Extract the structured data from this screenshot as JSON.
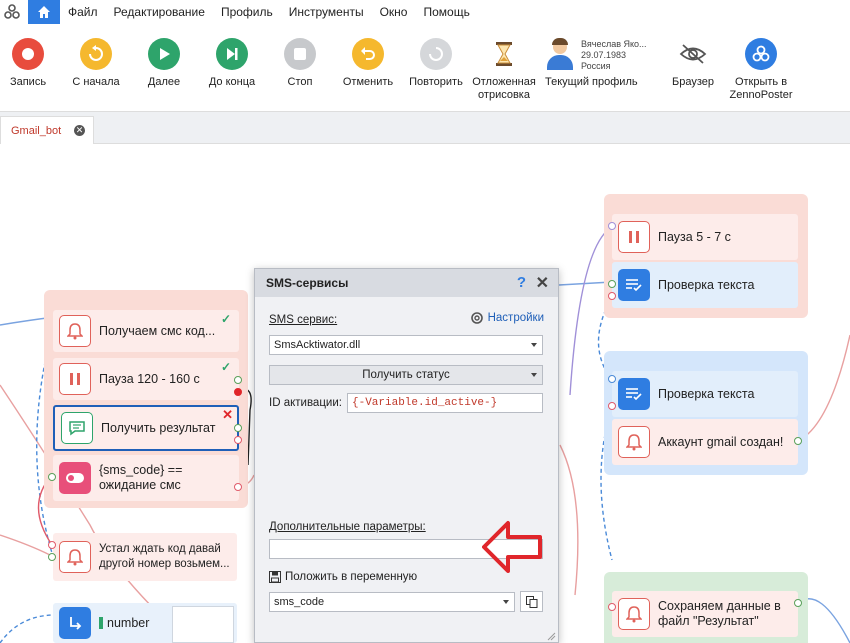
{
  "menu": {
    "items": [
      "Файл",
      "Редактирование",
      "Профиль",
      "Инструменты",
      "Окно",
      "Помощь"
    ]
  },
  "toolbar": {
    "record": "Запись",
    "from_start": "С начала",
    "next": "Далее",
    "to_end": "До конца",
    "stop": "Стоп",
    "undo": "Отменить",
    "repeat": "Повторить",
    "deferred_line1": "Отложенная",
    "deferred_line2": "отрисовка",
    "profile_name": "Вячеслав Яко...",
    "profile_date": "29.07.1983",
    "profile_country": "Россия",
    "current_profile": "Текущий профиль",
    "browser": "Браузер",
    "open_line1": "Открыть в",
    "open_line2": "ZennoPoster"
  },
  "tabs": {
    "active": "Gmail_bot"
  },
  "nodes": {
    "get_sms": "Получаем смс код...",
    "pause_120": "Пауза 120 - 160 с",
    "get_result": "Получить результат",
    "sms_code_cond_line1": "{sms_code} ==",
    "sms_code_cond_line2": "ожидание смс",
    "tired_line1": "Устал ждать код давай",
    "tired_line2": "другой номер возьмем...",
    "number": "number",
    "pause_5_7": "Пауза 5 - 7 с",
    "check_text_1": "Проверка текста",
    "check_text_2": "Проверка текста",
    "gmail_created": "Аккаунт gmail создан!",
    "save_line1": "Сохраняем данные в",
    "save_line2": "файл \"Результат\""
  },
  "dialog": {
    "title": "SMS-сервисы",
    "help": "?",
    "close": "✕",
    "service_label": "SMS сервис:",
    "settings": "Настройки",
    "service_value": "SmsAcktiwator.dll",
    "action_value": "Получить статус",
    "activation_label": "ID активации:",
    "activation_value": "{-Variable.id_active-}",
    "extra_label": "Дополнительные параметры:",
    "extra_value": "",
    "save_to_var": "Положить в переменную",
    "var_value": "sms_code"
  },
  "colors": {
    "accent": "#2f7de1",
    "group_red": "#fadcd6",
    "group_blue": "#d4e6fb",
    "group_green": "#d7ecd9",
    "arrow_red": "#e0262b"
  }
}
